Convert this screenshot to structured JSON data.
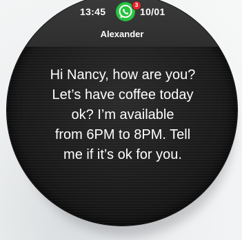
{
  "status_bar": {
    "time": "13:45",
    "date": "10/01",
    "app_icon": "whatsapp-icon",
    "notification_count": "3",
    "accent_color": "#27c240",
    "badge_color": "#e3262a"
  },
  "notification": {
    "sender": "Alexander",
    "message_lines": [
      "Hi Nancy, how are you?",
      "Let’s have coffee today",
      "ok? I’m available",
      "from 6PM to 8PM. Tell",
      "me if it’s ok for you."
    ]
  }
}
